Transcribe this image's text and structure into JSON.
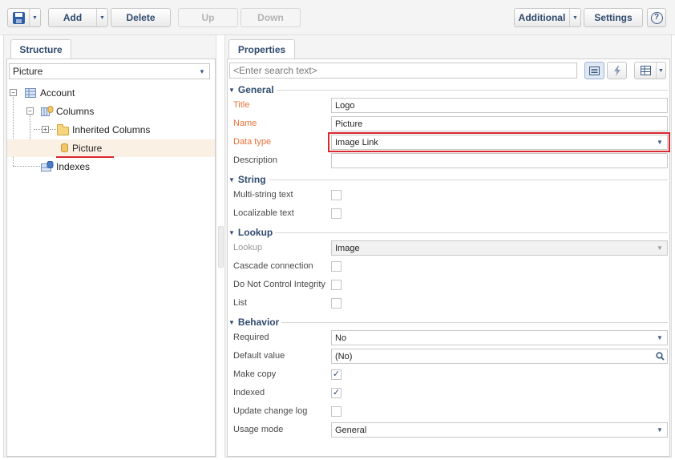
{
  "toolbar": {
    "add_label": "Add",
    "delete_label": "Delete",
    "up_label": "Up",
    "down_label": "Down",
    "additional_label": "Additional",
    "settings_label": "Settings",
    "help_glyph": "?",
    "caret": "▼"
  },
  "structure": {
    "tab_label": "Structure",
    "selector_value": "Picture",
    "tree": [
      {
        "label": "Account",
        "icon": "entity-icon"
      },
      {
        "label": "Columns",
        "icon": "columns-icon"
      },
      {
        "label": "Inherited Columns",
        "icon": "folder-icon"
      },
      {
        "label": "Picture",
        "icon": "column-icon"
      },
      {
        "label": "Indexes",
        "icon": "indexes-icon"
      }
    ]
  },
  "properties": {
    "tab_label": "Properties",
    "search_placeholder": "<Enter search text>",
    "sections": {
      "general": "General",
      "string": "String",
      "lookup": "Lookup",
      "behavior": "Behavior"
    },
    "fields": {
      "title_label": "Title",
      "title_value": "Logo",
      "name_label": "Name",
      "name_value": "Picture",
      "datatype_label": "Data type",
      "datatype_value": "Image Link",
      "description_label": "Description",
      "description_value": "",
      "multistring_label": "Multi-string text",
      "localizable_label": "Localizable text",
      "lookup_label": "Lookup",
      "lookup_value": "Image",
      "cascade_label": "Cascade connection",
      "dnci_label": "Do Not Control Integrity",
      "list_label": "List",
      "required_label": "Required",
      "required_value": "No",
      "default_label": "Default value",
      "default_value": "(No)",
      "makecopy_label": "Make copy",
      "indexed_label": "Indexed",
      "changelog_label": "Update change log",
      "usage_label": "Usage mode",
      "usage_value": "General"
    },
    "checkboxes": {
      "multistring": false,
      "localizable": false,
      "cascade": false,
      "dnci": false,
      "list": false,
      "makecopy": true,
      "indexed": true,
      "changelog": false
    }
  },
  "colors": {
    "accent": "#2f4a6e",
    "required_label": "#e8723a",
    "highlight": "#d9282f"
  }
}
